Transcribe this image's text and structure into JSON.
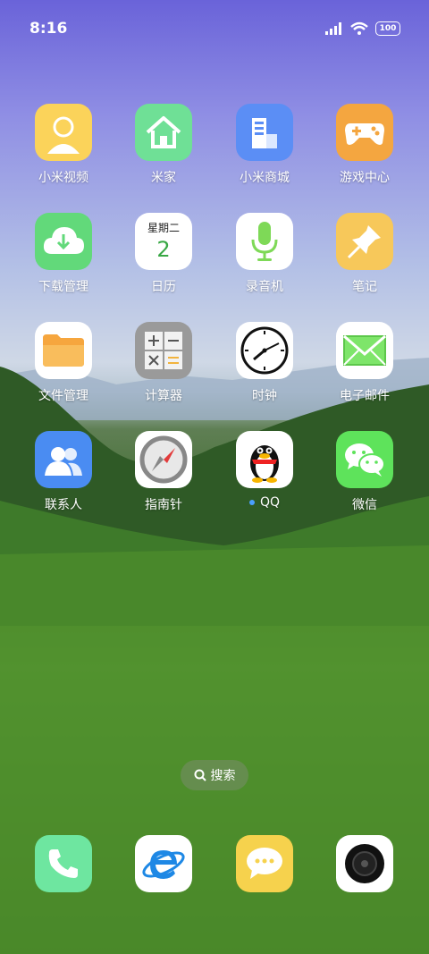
{
  "status": {
    "time": "8:16",
    "battery": "100"
  },
  "apps": [
    {
      "label": "小米视频",
      "icon": "person-icon"
    },
    {
      "label": "米家",
      "icon": "home-icon"
    },
    {
      "label": "小米商城",
      "icon": "building-icon"
    },
    {
      "label": "游戏中心",
      "icon": "gamepad-icon"
    },
    {
      "label": "下载管理",
      "icon": "download-cloud-icon"
    },
    {
      "label": "日历",
      "icon": "calendar-icon",
      "weekday": "星期二",
      "day": "2"
    },
    {
      "label": "录音机",
      "icon": "microphone-icon"
    },
    {
      "label": "笔记",
      "icon": "pin-icon"
    },
    {
      "label": "文件管理",
      "icon": "folder-icon"
    },
    {
      "label": "计算器",
      "icon": "calculator-icon"
    },
    {
      "label": "时钟",
      "icon": "clock-icon"
    },
    {
      "label": "电子邮件",
      "icon": "mail-icon"
    },
    {
      "label": "联系人",
      "icon": "contacts-icon"
    },
    {
      "label": "指南针",
      "icon": "compass-icon"
    },
    {
      "label": "QQ",
      "icon": "penguin-icon"
    },
    {
      "label": "微信",
      "icon": "wechat-icon"
    }
  ],
  "search": {
    "label": "搜索"
  },
  "dock": [
    {
      "icon": "phone-icon"
    },
    {
      "icon": "browser-icon"
    },
    {
      "icon": "message-icon"
    },
    {
      "icon": "camera-icon"
    }
  ]
}
